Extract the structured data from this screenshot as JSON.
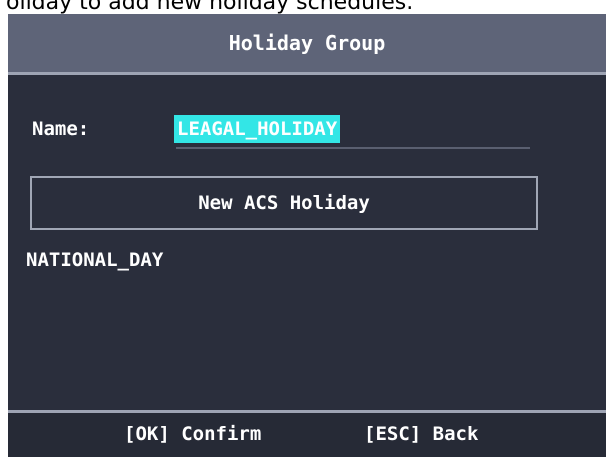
{
  "caption": "oliday to add new holiday schedules.",
  "title": "Holiday Group",
  "form": {
    "name_label": "Name:",
    "name_value": "LEAGAL_HOLIDAY"
  },
  "new_button_label": "New ACS Holiday",
  "holidays": [
    "NATIONAL_DAY"
  ],
  "footer": {
    "confirm": "[OK] Confirm",
    "back": "[ESC] Back"
  },
  "colors": {
    "title_bar": "#5e6478",
    "screen_bg": "#2a2e3c",
    "highlight": "#33e6e6"
  }
}
